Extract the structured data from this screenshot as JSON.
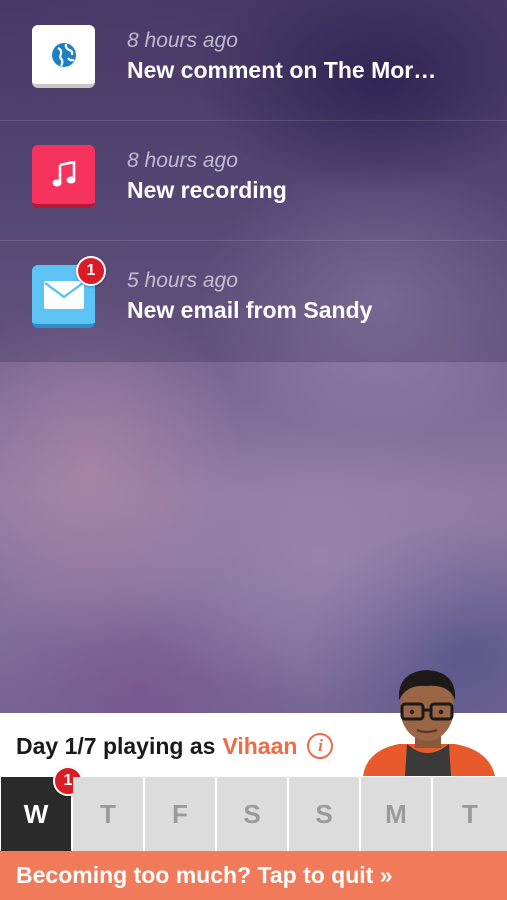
{
  "notifications": [
    {
      "app": "web",
      "icon": "globe-icon",
      "time": "8 hours ago",
      "title": "New comment on The Mor…",
      "badge": ""
    },
    {
      "app": "music",
      "icon": "music-note-icon",
      "time": "8 hours ago",
      "title": "New recording",
      "badge": ""
    },
    {
      "app": "mail",
      "icon": "envelope-icon",
      "time": "5 hours ago",
      "title": "New email from Sandy",
      "badge": "1"
    }
  ],
  "game": {
    "day_text": "Day 1/7 playing as",
    "player_name": "Vihaan",
    "info_glyph": "i",
    "days": [
      "W",
      "T",
      "F",
      "S",
      "S",
      "M",
      "T"
    ],
    "active_day_index": 0,
    "active_day_badge": "1",
    "quit_label": "Becoming too much? Tap to quit »"
  },
  "colors": {
    "accent": "#ef6a45",
    "quit_bar": "#f07a59",
    "badge": "#d91c25",
    "active_day": "#2b2b2b",
    "inactive_day": "#dcdcdc"
  }
}
